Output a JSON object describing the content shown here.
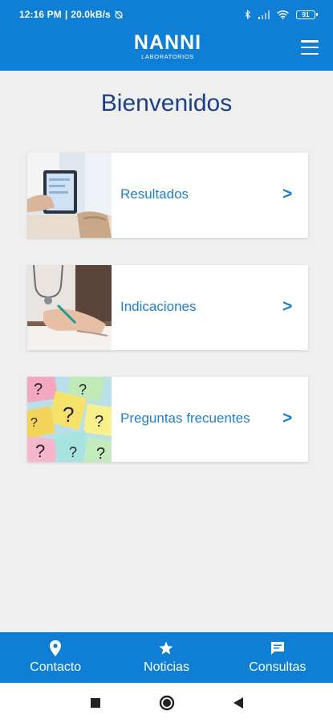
{
  "status_bar": {
    "time": "12:16 PM",
    "separator": "|",
    "speed": "20.0kB/s",
    "battery": "91"
  },
  "header": {
    "logo": "NANNI",
    "logo_sub": "LABORATORIOS"
  },
  "main": {
    "title": "Bienvenidos",
    "cards": [
      {
        "label": "Resultados",
        "arrow": ">"
      },
      {
        "label": "Indicaciones",
        "arrow": ">"
      },
      {
        "label": "Preguntas frecuentes",
        "arrow": ">"
      }
    ]
  },
  "bottom_nav": {
    "items": [
      {
        "label": "Contacto",
        "icon": "location-pin-icon"
      },
      {
        "label": "Noticias",
        "icon": "star-icon"
      },
      {
        "label": "Consultas",
        "icon": "chat-icon"
      }
    ]
  },
  "colors": {
    "primary": "#0f7fd6",
    "title": "#1d3f8a",
    "link": "#1f7fcc",
    "background": "#efefef"
  }
}
